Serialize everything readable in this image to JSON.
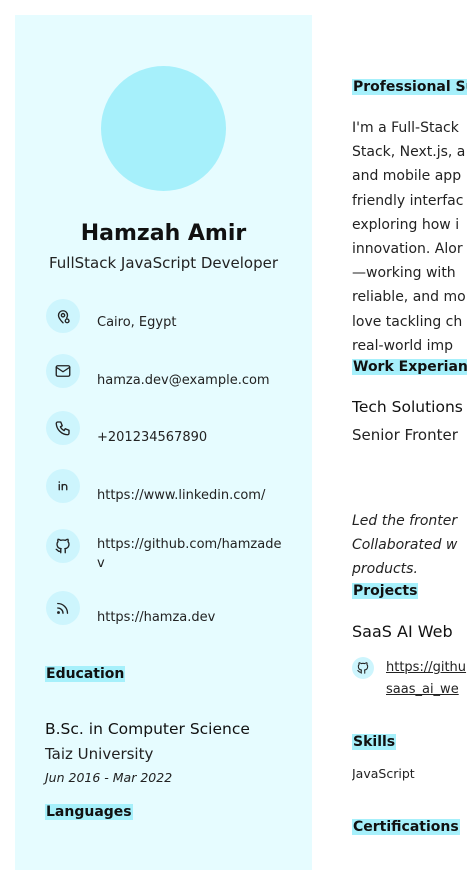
{
  "profile": {
    "name": "Hamzah Amir",
    "role": "FullStack JavaScript Developer"
  },
  "contacts": [
    {
      "icon": "location-icon",
      "text": "Cairo, Egypt"
    },
    {
      "icon": "mail-icon",
      "text": "hamza.dev@example.com"
    },
    {
      "icon": "phone-icon",
      "text": "+201234567890"
    },
    {
      "icon": "linkedin-icon",
      "text": "https://www.linkedin.com/"
    },
    {
      "icon": "github-icon",
      "text": "https://github.com/hamzadev"
    },
    {
      "icon": "rss-icon",
      "text": "https://hamza.dev"
    }
  ],
  "education": {
    "title": "Education",
    "degree": "B.Sc. in Computer Science",
    "school": "Taiz University",
    "dates": "Jun 2016 - Mar 2022"
  },
  "languages": {
    "title": "Languages"
  },
  "summary": {
    "title": "Professional Su",
    "lines": [
      "I'm a Full-Stack",
      "Stack, Next.js, a",
      "and mobile app",
      "friendly interfac",
      "exploring how i",
      "innovation. Alor",
      "—working with",
      "reliable, and mo",
      "love tackling ch",
      "real-world imp"
    ]
  },
  "work": {
    "title": "Work Experianc",
    "company": "Tech Solutions",
    "job_title": "Senior Fronter",
    "desc_lines": [
      "Led the fronter",
      "Collaborated w",
      "products."
    ]
  },
  "projects": {
    "title": "Projects",
    "name": "SaaS AI Web",
    "link_lines": [
      "https://githu",
      "saas_ai_we"
    ]
  },
  "skills": {
    "title": "Skills",
    "item": "JavaScript"
  },
  "certifications": {
    "title": "Certifications"
  },
  "colors": {
    "sidebar_bg": "#e6fcff",
    "accent": "#a6f0fb",
    "icon_bg": "#cdf5fd"
  }
}
